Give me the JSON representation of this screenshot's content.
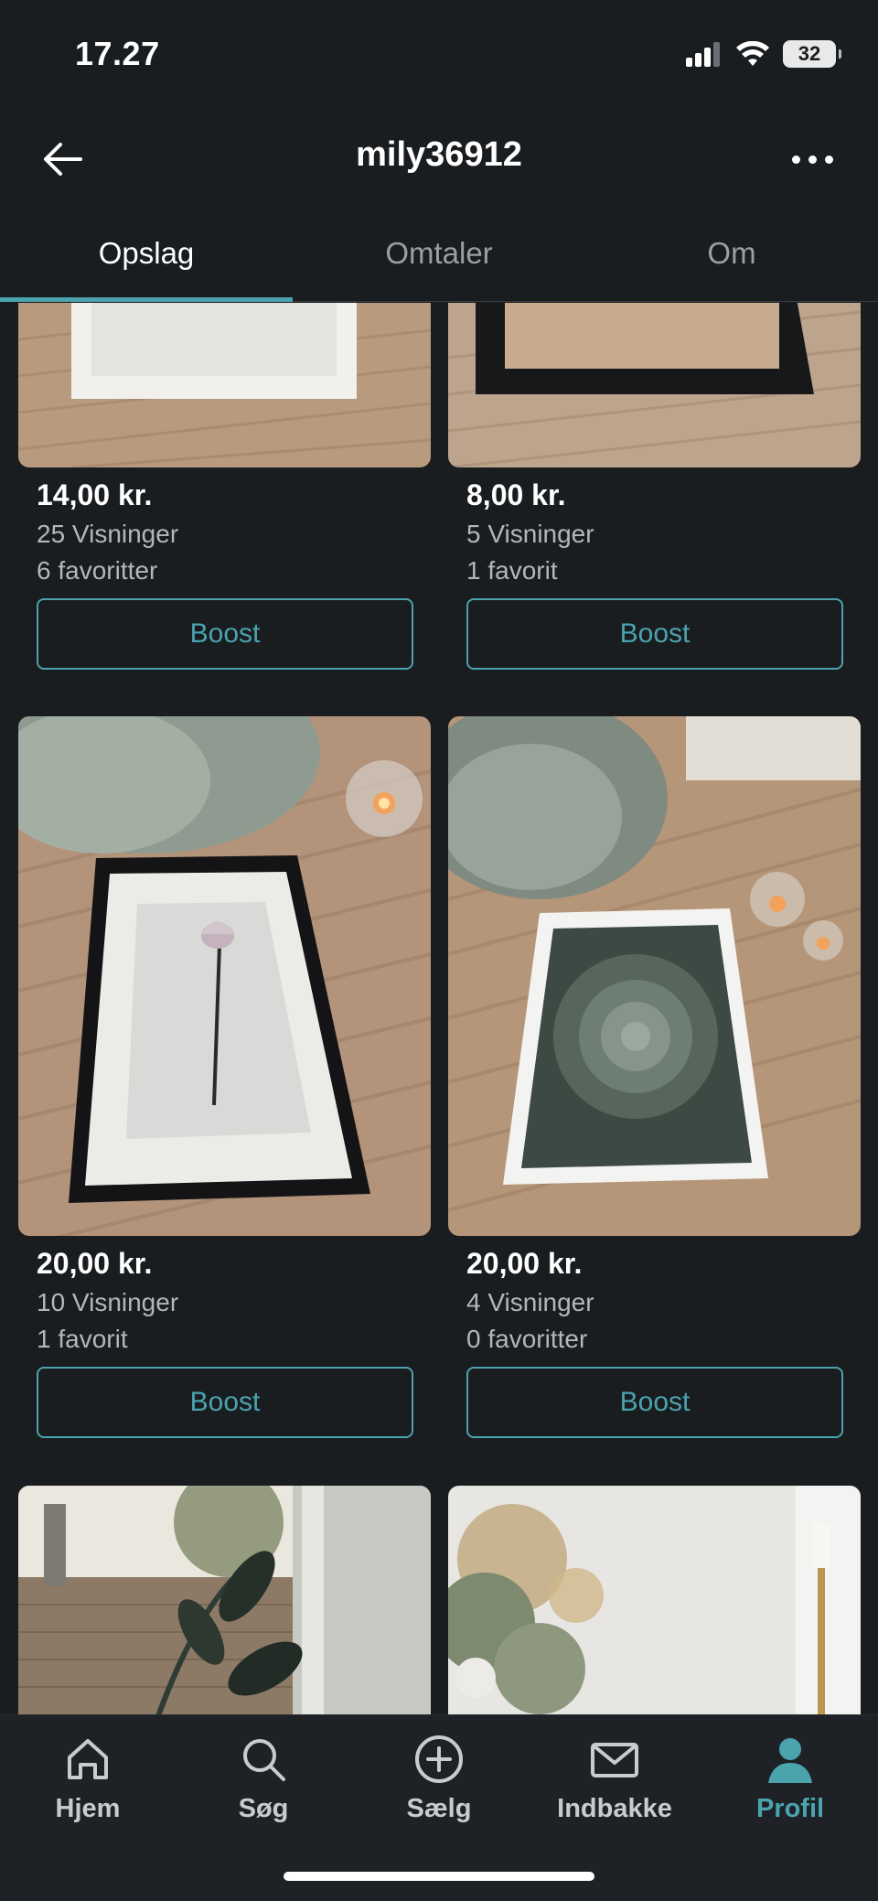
{
  "status": {
    "time": "17.27",
    "battery": "32"
  },
  "header": {
    "title": "mily36912"
  },
  "tabs": [
    {
      "label": "Opslag",
      "active": true
    },
    {
      "label": "Omtaler",
      "active": false
    },
    {
      "label": "Om",
      "active": false
    }
  ],
  "listings": [
    {
      "price": "14,00 kr.",
      "views": "25 Visninger",
      "favorites": "6 favoritter",
      "action": "Boost"
    },
    {
      "price": "8,00 kr.",
      "views": "5 Visninger",
      "favorites": "1 favorit",
      "action": "Boost"
    },
    {
      "price": "20,00 kr.",
      "views": "10 Visninger",
      "favorites": "1 favorit",
      "action": "Boost"
    },
    {
      "price": "20,00 kr.",
      "views": "4 Visninger",
      "favorites": "0 favoritter",
      "action": "Boost"
    }
  ],
  "bottom_nav": [
    {
      "label": "Hjem",
      "icon": "home-icon",
      "active": false
    },
    {
      "label": "Søg",
      "icon": "search-icon",
      "active": false
    },
    {
      "label": "Sælg",
      "icon": "plus-circle-icon",
      "active": false
    },
    {
      "label": "Indbakke",
      "icon": "mail-icon",
      "active": false
    },
    {
      "label": "Profil",
      "icon": "profile-icon",
      "active": true
    }
  ],
  "colors": {
    "accent": "#4aa3ad",
    "background": "#1a1d20"
  }
}
